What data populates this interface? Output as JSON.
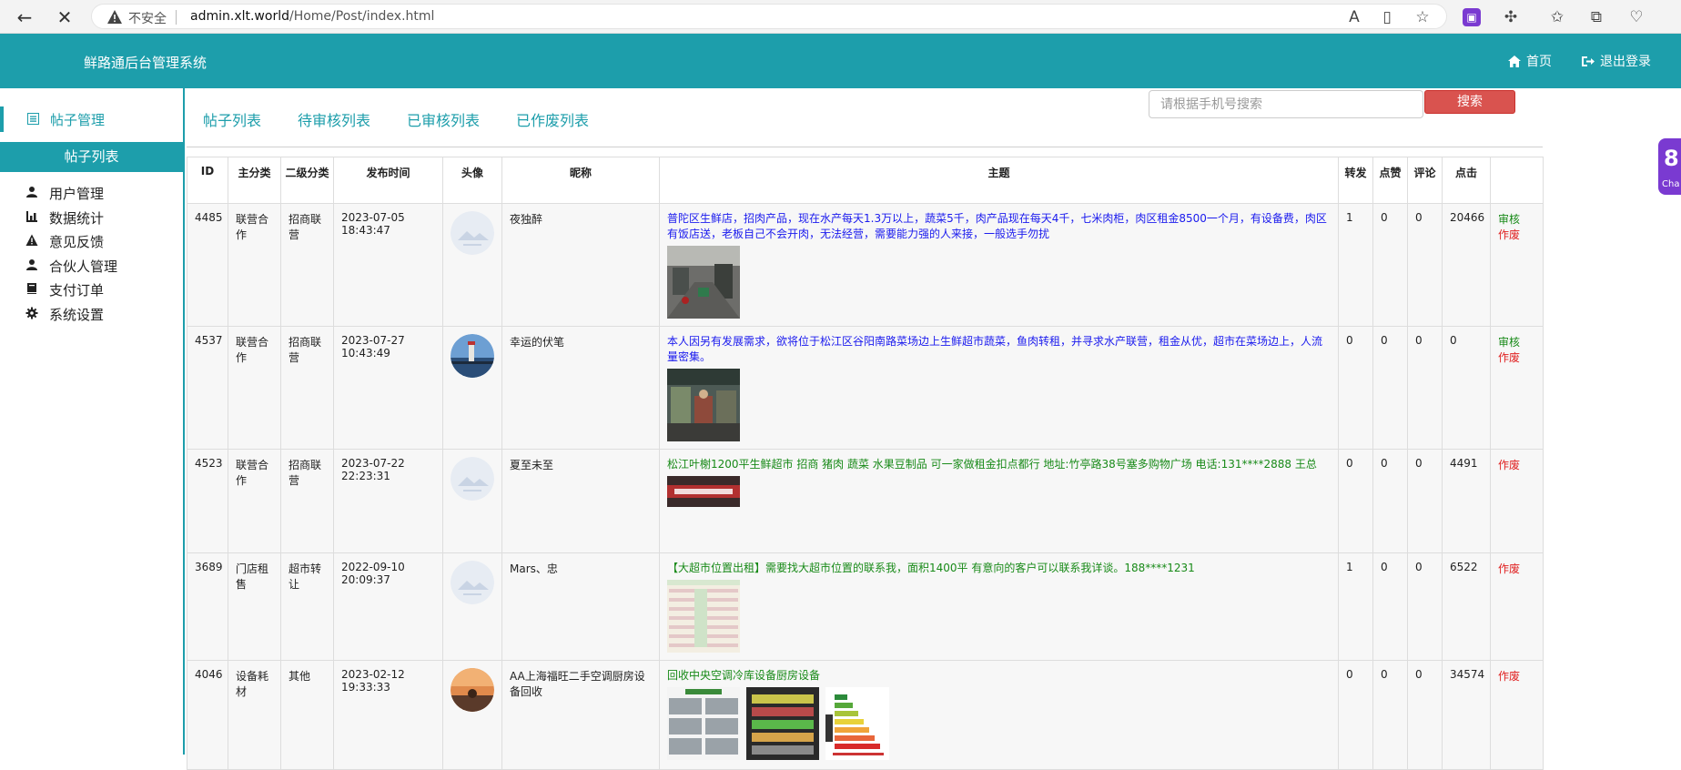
{
  "browser": {
    "not_secure": "不安全",
    "url_host": "admin.xlt.world",
    "url_path": "/Home/Post/index.html"
  },
  "header": {
    "title": "鲜路通后台管理系统",
    "home": "首页",
    "logout": "退出登录"
  },
  "sidebar": {
    "active": "帖子管理",
    "sub_active": "帖子列表",
    "items": [
      {
        "label": "用户管理",
        "icon": "user-icon"
      },
      {
        "label": "数据统计",
        "icon": "chart-icon"
      },
      {
        "label": "意见反馈",
        "icon": "warning-icon"
      },
      {
        "label": "合伙人管理",
        "icon": "user-icon"
      },
      {
        "label": "支付订单",
        "icon": "book-icon"
      },
      {
        "label": "系统设置",
        "icon": "gear-icon"
      }
    ]
  },
  "tabs": [
    "帖子列表",
    "待审核列表",
    "已审核列表",
    "已作废列表"
  ],
  "search": {
    "placeholder": "请根据手机号搜索",
    "button": "搜索"
  },
  "table": {
    "headers": [
      "ID",
      "主分类",
      "二级分类",
      "发布时间",
      "头像",
      "昵称",
      "主题",
      "转发",
      "点赞",
      "评论",
      "点击",
      ""
    ],
    "rows": [
      {
        "id": "4485",
        "main": "联营合作",
        "sub": "招商联营",
        "date": "2023-07-05",
        "time": "18:43:47",
        "nick": "夜独醉",
        "subject": "普陀区生鲜店，招肉产品，现在水产每天1.3万以上，蔬菜5千，肉产品现在每天4千，七米肉柜，肉区租金8500一个月，有设备费，肉区有饭店送，老板自己不会开肉，无法经营，需要能力强的人来接，一般选手勿扰",
        "subject_color": "blue",
        "fwd": "1",
        "like": "0",
        "cmt": "0",
        "clk": "20466",
        "audit": "审核",
        "void": "作废"
      },
      {
        "id": "4537",
        "main": "联营合作",
        "sub": "招商联营",
        "date": "2023-07-27",
        "time": "10:43:49",
        "nick": "幸运的伏笔",
        "subject": "本人因另有发展需求，欲将位于松江区谷阳南路菜场边上生鲜超市蔬菜，鱼肉转租，并寻求水产联营，租金从优，超市在菜场边上，人流量密集。",
        "subject_color": "blue",
        "fwd": "0",
        "like": "0",
        "cmt": "0",
        "clk": "0",
        "audit": "审核",
        "void": "作废"
      },
      {
        "id": "4523",
        "main": "联营合作",
        "sub": "招商联营",
        "date": "2023-07-22",
        "time": "22:23:31",
        "nick": "夏至未至",
        "subject": "松江叶榭1200平生鲜超市 招商 猪肉 蔬菜 水果豆制品 可一家做租金扣点都行 地址:竹亭路38号塞多购物广场 电话:131****2888 王总",
        "subject_color": "green",
        "fwd": "0",
        "like": "0",
        "cmt": "0",
        "clk": "4491",
        "audit": "",
        "void": "作废"
      },
      {
        "id": "3689",
        "main": "门店租售",
        "sub": "超市转让",
        "date": "2022-09-10",
        "time": "20:09:37",
        "nick": "Mars、忠",
        "subject": "【大超市位置出租】需要找大超市位置的联系我，面积1400平 有意向的客户可以联系我详谈。188****1231",
        "subject_color": "green",
        "fwd": "1",
        "like": "0",
        "cmt": "0",
        "clk": "6522",
        "audit": "",
        "void": "作废"
      },
      {
        "id": "4046",
        "main": "设备耗材",
        "sub": "其他",
        "date": "2023-02-12",
        "time": "19:33:33",
        "nick": "AA上海福旺二手空调厨房设备回收",
        "subject": "回收中央空调冷库设备厨房设备",
        "subject_color": "green",
        "fwd": "0",
        "like": "0",
        "cmt": "0",
        "clk": "34574",
        "audit": "",
        "void": "作废"
      }
    ]
  },
  "side_widget": {
    "label": "Cha"
  }
}
